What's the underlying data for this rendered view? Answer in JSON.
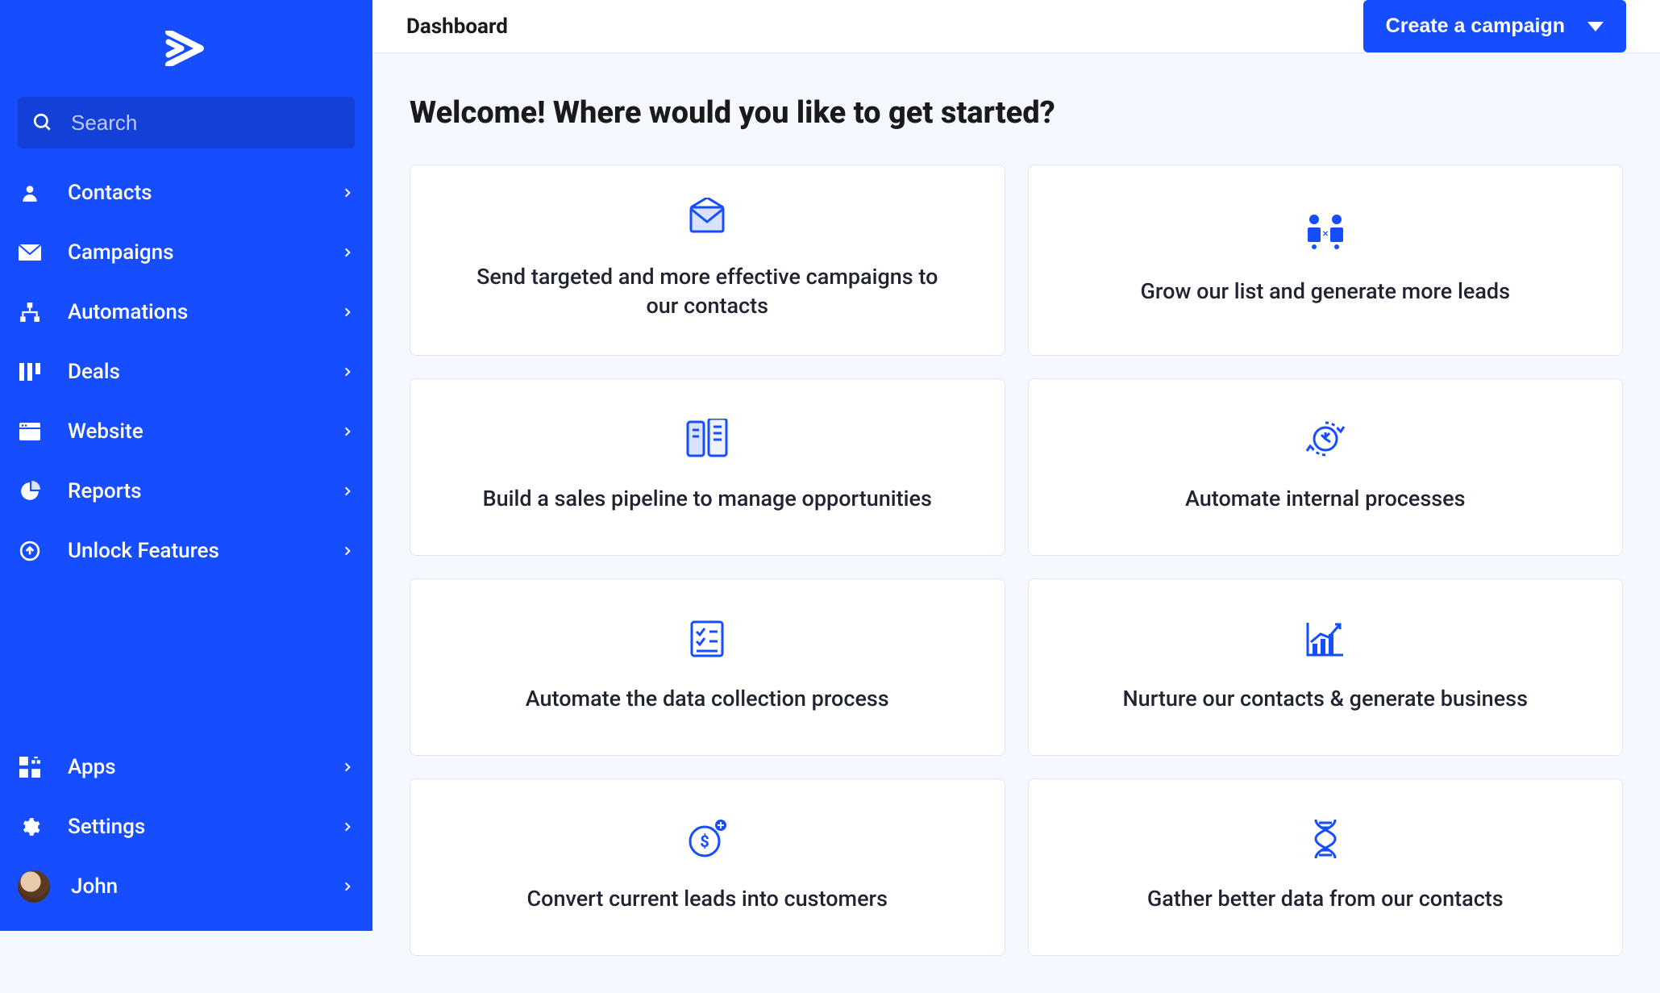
{
  "search": {
    "placeholder": "Search"
  },
  "nav": [
    {
      "label": "Contacts"
    },
    {
      "label": "Campaigns"
    },
    {
      "label": "Automations"
    },
    {
      "label": "Deals"
    },
    {
      "label": "Website"
    },
    {
      "label": "Reports"
    },
    {
      "label": "Unlock Features"
    }
  ],
  "bottomNav": [
    {
      "label": "Apps"
    },
    {
      "label": "Settings"
    },
    {
      "label": "John"
    }
  ],
  "header": {
    "title": "Dashboard",
    "cta": "Create a campaign"
  },
  "welcome": "Welcome! Where would you like to get started?",
  "cards": [
    {
      "label": "Send targeted and more effective campaigns to our contacts"
    },
    {
      "label": "Grow our list and generate more leads"
    },
    {
      "label": "Build a sales pipeline to manage opportunities"
    },
    {
      "label": "Automate internal processes"
    },
    {
      "label": "Automate the data collection process"
    },
    {
      "label": "Nurture our contacts & generate business"
    },
    {
      "label": "Convert current leads into customers"
    },
    {
      "label": "Gather better data from our contacts"
    }
  ]
}
